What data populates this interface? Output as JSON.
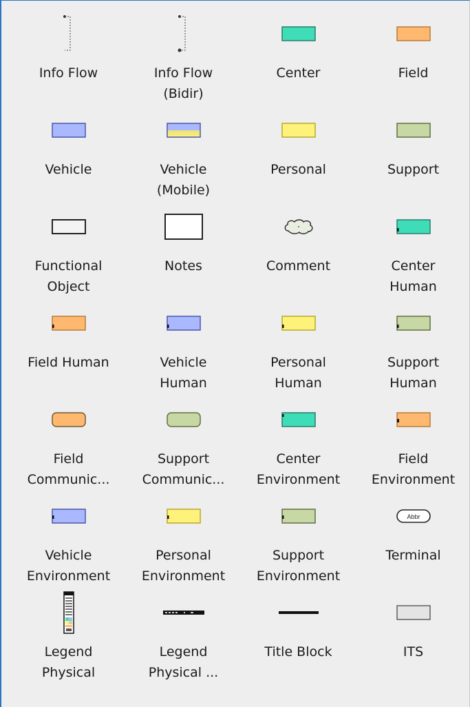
{
  "toolbox": {
    "items": [
      {
        "label": "Info Flow",
        "icon": "info-flow-icon"
      },
      {
        "label": "Info Flow\n(Bidir)",
        "icon": "info-flow-bidir-icon"
      },
      {
        "label": "Center",
        "icon": "center-icon"
      },
      {
        "label": "Field",
        "icon": "field-icon"
      },
      {
        "label": "Vehicle",
        "icon": "vehicle-icon"
      },
      {
        "label": "Vehicle\n(Mobile)",
        "icon": "vehicle-mobile-icon"
      },
      {
        "label": "Personal",
        "icon": "personal-icon"
      },
      {
        "label": "Support",
        "icon": "support-icon"
      },
      {
        "label": "Functional\nObject",
        "icon": "functional-object-icon"
      },
      {
        "label": "Notes",
        "icon": "notes-icon"
      },
      {
        "label": "Comment",
        "icon": "comment-icon"
      },
      {
        "label": "Center\nHuman",
        "icon": "center-human-icon"
      },
      {
        "label": "Field Human",
        "icon": "field-human-icon"
      },
      {
        "label": "Vehicle\nHuman",
        "icon": "vehicle-human-icon"
      },
      {
        "label": "Personal\nHuman",
        "icon": "personal-human-icon"
      },
      {
        "label": "Support\nHuman",
        "icon": "support-human-icon"
      },
      {
        "label": "Field\nCommunic...",
        "icon": "field-communications-icon"
      },
      {
        "label": "Support\nCommunic...",
        "icon": "support-communications-icon"
      },
      {
        "label": "Center\nEnvironment",
        "icon": "center-environment-icon"
      },
      {
        "label": "Field\nEnvironment",
        "icon": "field-environment-icon"
      },
      {
        "label": "Vehicle\nEnvironment",
        "icon": "vehicle-environment-icon"
      },
      {
        "label": "Personal\nEnvironment",
        "icon": "personal-environment-icon"
      },
      {
        "label": "Support\nEnvironment",
        "icon": "support-environment-icon"
      },
      {
        "label": "Terminal",
        "icon": "terminal-icon",
        "abbr": "Abbr"
      },
      {
        "label": "Legend\nPhysical",
        "icon": "legend-physical-icon"
      },
      {
        "label": "Legend\nPhysical ...",
        "icon": "legend-physical-2-icon"
      },
      {
        "label": "Title Block",
        "icon": "title-block-icon"
      },
      {
        "label": "ITS",
        "icon": "its-icon"
      }
    ]
  },
  "colors": {
    "panel_bg": "#eeeeee",
    "accent_border": "#2a74c4",
    "center": "#3fdcb8",
    "field": "#ffb870",
    "vehicle": "#aab8ff",
    "personal": "#fff27a",
    "support": "#c8d8a4",
    "white": "#ffffff",
    "its": "#e4e4e4"
  }
}
